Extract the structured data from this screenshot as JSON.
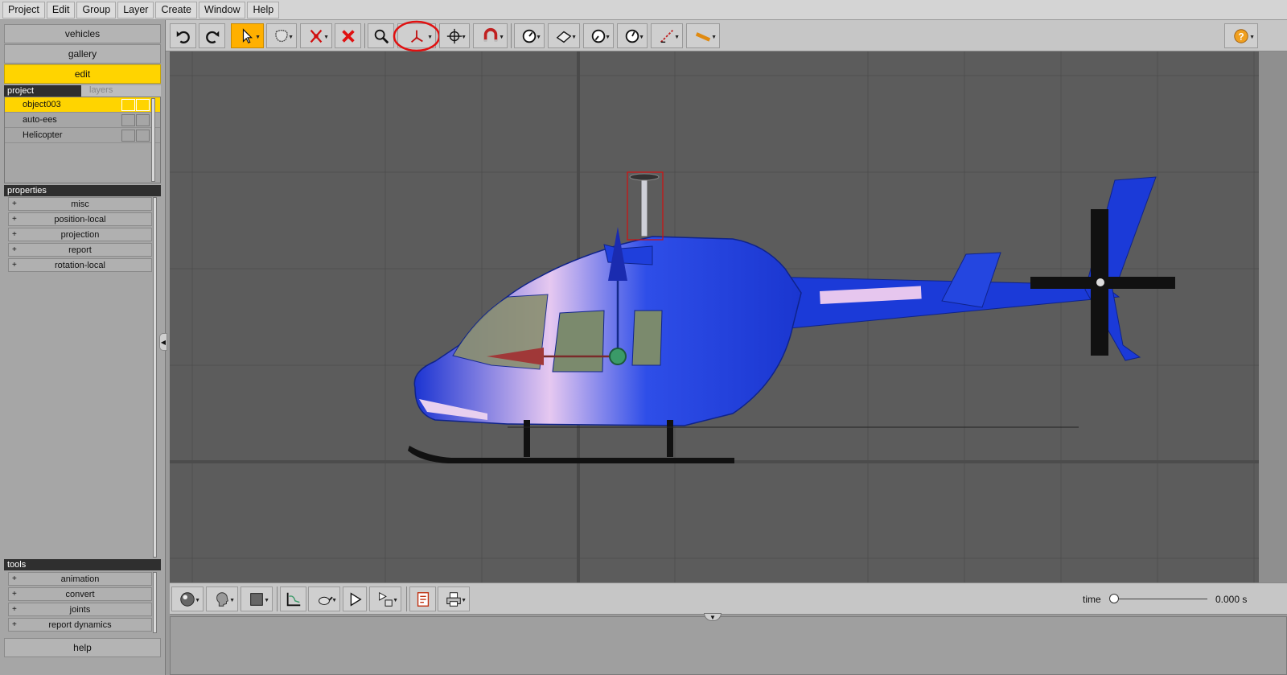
{
  "menubar": {
    "items": [
      "Project",
      "Edit",
      "Group",
      "Layer",
      "Create",
      "Window",
      "Help"
    ]
  },
  "sidebar": {
    "nav": {
      "vehicles": "vehicles",
      "gallery": "gallery",
      "edit": "edit"
    },
    "project_tab": "project",
    "layers_tab": "layers",
    "objects": [
      {
        "name": "object003",
        "selected": true
      },
      {
        "name": "auto-ees",
        "selected": false
      },
      {
        "name": "Helicopter",
        "selected": false
      }
    ],
    "properties_header": "properties",
    "properties": [
      "misc",
      "position-local",
      "projection",
      "report",
      "rotation-local"
    ],
    "tools_header": "tools",
    "tools": [
      "animation",
      "convert",
      "joints",
      "report dynamics"
    ],
    "help": "help",
    "expander_symbol": "+"
  },
  "toolbar": {
    "tools": [
      {
        "icon": "undo-icon"
      },
      {
        "icon": "redo-icon"
      },
      {
        "icon": "select-arrow-icon",
        "active": true
      },
      {
        "icon": "lasso-icon"
      },
      {
        "icon": "cut-icon"
      },
      {
        "icon": "delete-icon",
        "color": "#e01010"
      },
      {
        "icon": "zoom-icon"
      },
      {
        "icon": "axes-icon",
        "highlighted": true,
        "highlight_color": "#e01010"
      },
      {
        "icon": "move-icon"
      },
      {
        "icon": "magnet-icon"
      },
      {
        "icon": "gauge-icon"
      },
      {
        "icon": "plane-icon"
      },
      {
        "icon": "angle-gauge-icon"
      },
      {
        "icon": "rotate-gauge-icon"
      },
      {
        "icon": "measure-icon"
      },
      {
        "icon": "ruler-icon"
      }
    ],
    "help_icon": "help-icon"
  },
  "viewport": {
    "background": "#5c5c5c",
    "grid_color": "#4e4e4e",
    "helicopter_color": "#1a3fd6"
  },
  "bottombar": {
    "tools": [
      {
        "icon": "sphere-shading-icon"
      },
      {
        "icon": "head-icon"
      },
      {
        "icon": "color-square-icon"
      },
      {
        "icon": "graph-icon"
      },
      {
        "icon": "teapot-icon"
      },
      {
        "icon": "play-icon"
      },
      {
        "icon": "play-options-icon"
      },
      {
        "icon": "report-icon"
      },
      {
        "icon": "print-icon"
      }
    ],
    "time_label": "time",
    "time_value": "0.000 s",
    "time_fraction": 0
  }
}
